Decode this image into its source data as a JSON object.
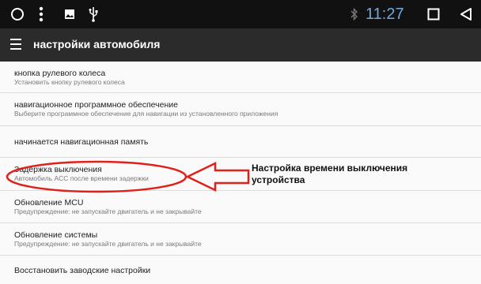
{
  "status_bar": {
    "icons": [
      "circle-icon",
      "more-vert-icon",
      "image-icon",
      "usb-icon",
      "bluetooth-icon",
      "square-icon",
      "back-triangle-icon"
    ],
    "time": "11:27"
  },
  "app_bar": {
    "menu_icon": "menu-icon",
    "title": "настройки автомобиля"
  },
  "settings": [
    {
      "title": "кнопка рулевого колеса",
      "subtitle": "Установить кнопку рулевого колеса"
    },
    {
      "title": "навигационное программное обеспечение",
      "subtitle": "Выберите программное обеспечение для навигации из установленного приложения"
    },
    {
      "title": "начинается навигационная память",
      "subtitle": ""
    },
    {
      "title": "Задержка выключения",
      "subtitle": "Автомобиль ACC после времени задержки"
    },
    {
      "title": "Обновление MCU",
      "subtitle": "Предупреждение: не запускайте двигатель и не закрывайте"
    },
    {
      "title": "Обновление системы",
      "subtitle": "Предупреждение: не запускайте двигатель и не закрывайте"
    },
    {
      "title": "Восстановить заводские настройки",
      "subtitle": ""
    }
  ],
  "annotation": {
    "line1": "Настройка времени выключения",
    "line2": "устройства",
    "color": "#e0201b"
  }
}
